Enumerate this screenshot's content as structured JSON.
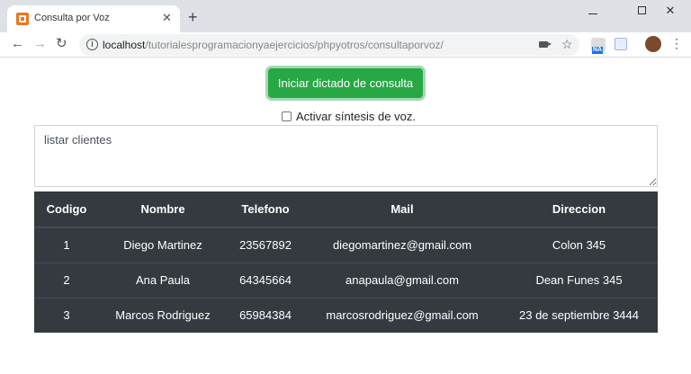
{
  "browser": {
    "tab_title": "Consulta por Voz",
    "tab_close": "✕",
    "new_tab": "+",
    "url_host": "localhost",
    "url_path": "/tutorialesprogramacionyaejercicios/phpyotros/consultaporvoz/",
    "info_glyph": "i",
    "extension_badge": "NA",
    "icons": [
      "back-icon",
      "forward-icon",
      "reload-icon",
      "info-icon",
      "camera-icon",
      "star-icon",
      "extension-icon",
      "avatar",
      "menu-icon"
    ]
  },
  "page": {
    "dictate_button": "Iniciar dictado de consulta",
    "synthesis_label": "Activar síntesis de voz.",
    "synthesis_checked": false,
    "query_text": "listar clientes"
  },
  "table": {
    "headers": [
      "Codigo",
      "Nombre",
      "Telefono",
      "Mail",
      "Direccion"
    ],
    "rows": [
      [
        "1",
        "Diego Martinez",
        "23567892",
        "diegomartinez@gmail.com",
        "Colon 345"
      ],
      [
        "2",
        "Ana Paula",
        "64345664",
        "anapaula@gmail.com",
        "Dean Funes 345"
      ],
      [
        "3",
        "Marcos Rodriguez",
        "65984384",
        "marcosrodriguez@gmail.com",
        "23 de septiembre 3444"
      ]
    ]
  },
  "colors": {
    "button_green": "#28a745",
    "table_dark": "#343a40",
    "chrome_tabbar": "#dee1e6"
  }
}
